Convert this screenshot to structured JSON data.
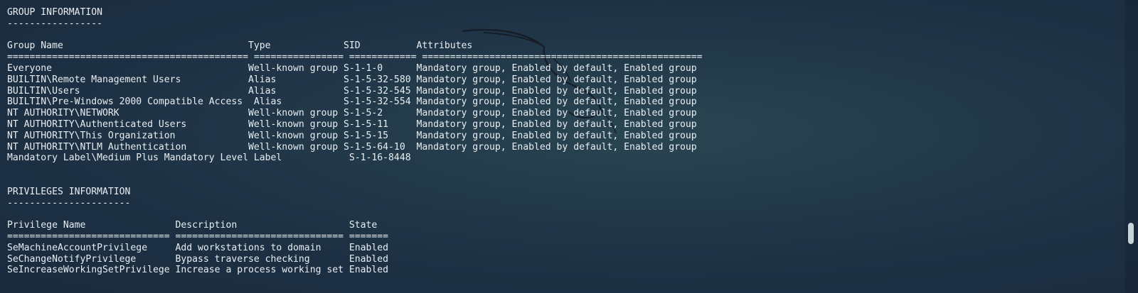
{
  "colors": {
    "text": "#e8eef2",
    "scroll_thumb": "#c9d2d8"
  },
  "watermark_icon": "kali-dragon-icon",
  "scroll_position": 0.82,
  "lines": [
    "GROUP INFORMATION",
    "-----------------",
    "",
    "Group Name                                 Type             SID          Attributes",
    "=========================================== ================ ============ ==================================================",
    "Everyone                                   Well-known group S-1-1-0      Mandatory group, Enabled by default, Enabled group",
    "BUILTIN\\Remote Management Users            Alias            S-1-5-32-580 Mandatory group, Enabled by default, Enabled group",
    "BUILTIN\\Users                              Alias            S-1-5-32-545 Mandatory group, Enabled by default, Enabled group",
    "BUILTIN\\Pre-Windows 2000 Compatible Access  Alias           S-1-5-32-554 Mandatory group, Enabled by default, Enabled group",
    "NT AUTHORITY\\NETWORK                       Well-known group S-1-5-2      Mandatory group, Enabled by default, Enabled group",
    "NT AUTHORITY\\Authenticated Users           Well-known group S-1-5-11     Mandatory group, Enabled by default, Enabled group",
    "NT AUTHORITY\\This Organization             Well-known group S-1-5-15     Mandatory group, Enabled by default, Enabled group",
    "NT AUTHORITY\\NTLM Authentication           Well-known group S-1-5-64-10  Mandatory group, Enabled by default, Enabled group",
    "Mandatory Label\\Medium Plus Mandatory Level Label            S-1-16-8448",
    "",
    "",
    "PRIVILEGES INFORMATION",
    "----------------------",
    "",
    "Privilege Name                Description                    State",
    "============================= ============================== =======",
    "SeMachineAccountPrivilege     Add workstations to domain     Enabled",
    "SeChangeNotifyPrivilege       Bypass traverse checking       Enabled",
    "SeIncreaseWorkingSetPrivilege Increase a process working set Enabled"
  ]
}
